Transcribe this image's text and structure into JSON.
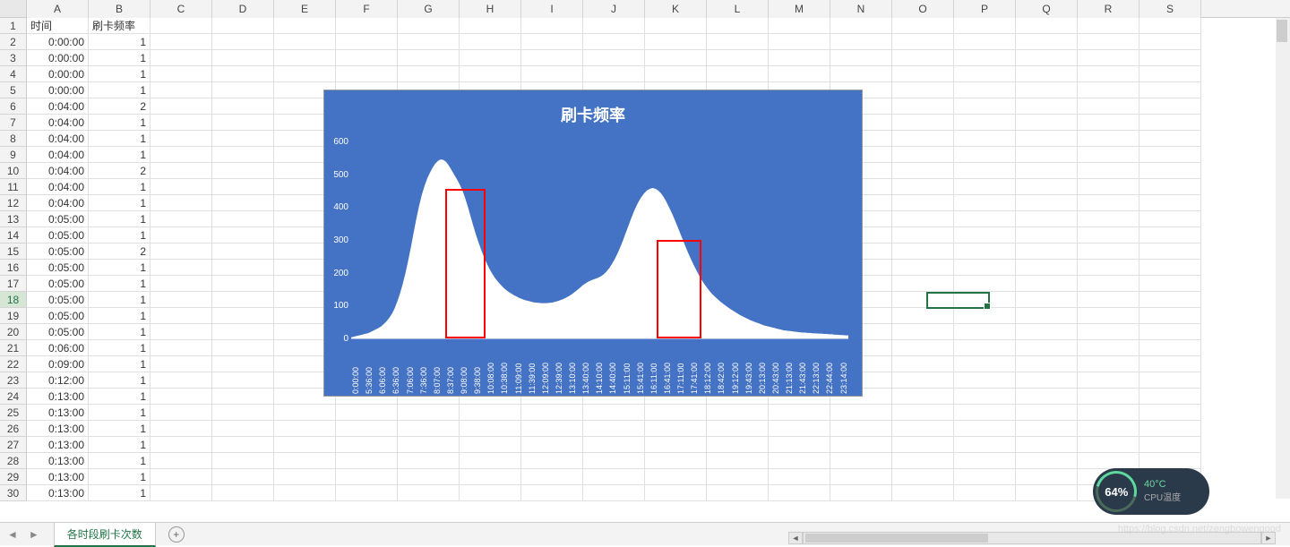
{
  "columns": [
    "A",
    "B",
    "C",
    "D",
    "E",
    "F",
    "G",
    "H",
    "I",
    "J",
    "K",
    "L",
    "M",
    "N",
    "O",
    "P",
    "Q",
    "R",
    "S"
  ],
  "row_count": 30,
  "headers": {
    "col_a": "时间",
    "col_b": "刷卡频率"
  },
  "data_rows": [
    {
      "time": "0:00:00",
      "freq": 1
    },
    {
      "time": "0:00:00",
      "freq": 1
    },
    {
      "time": "0:00:00",
      "freq": 1
    },
    {
      "time": "0:00:00",
      "freq": 1
    },
    {
      "time": "0:04:00",
      "freq": 2
    },
    {
      "time": "0:04:00",
      "freq": 1
    },
    {
      "time": "0:04:00",
      "freq": 1
    },
    {
      "time": "0:04:00",
      "freq": 1
    },
    {
      "time": "0:04:00",
      "freq": 2
    },
    {
      "time": "0:04:00",
      "freq": 1
    },
    {
      "time": "0:04:00",
      "freq": 1
    },
    {
      "time": "0:05:00",
      "freq": 1
    },
    {
      "time": "0:05:00",
      "freq": 1
    },
    {
      "time": "0:05:00",
      "freq": 2
    },
    {
      "time": "0:05:00",
      "freq": 1
    },
    {
      "time": "0:05:00",
      "freq": 1
    },
    {
      "time": "0:05:00",
      "freq": 1
    },
    {
      "time": "0:05:00",
      "freq": 1
    },
    {
      "time": "0:05:00",
      "freq": 1
    },
    {
      "time": "0:06:00",
      "freq": 1
    },
    {
      "time": "0:09:00",
      "freq": 1
    },
    {
      "time": "0:12:00",
      "freq": 1
    },
    {
      "time": "0:13:00",
      "freq": 1
    },
    {
      "time": "0:13:00",
      "freq": 1
    },
    {
      "time": "0:13:00",
      "freq": 1
    },
    {
      "time": "0:13:00",
      "freq": 1
    },
    {
      "time": "0:13:00",
      "freq": 1
    },
    {
      "time": "0:13:00",
      "freq": 1
    },
    {
      "time": "0:13:00",
      "freq": 1
    }
  ],
  "active_row": 18,
  "selected_cell": "O18",
  "sheet_tab": "各时段刷卡次数",
  "cpu_widget": {
    "percent": "64%",
    "temp": "40°C",
    "label": "CPU温度"
  },
  "watermark": "https://blog.csdn.net/zengbowengood",
  "chart_data": {
    "type": "area",
    "title": "刷卡频率",
    "ylabel": "",
    "xlabel": "",
    "ylim": [
      0,
      600
    ],
    "y_ticks": [
      0,
      100,
      200,
      300,
      400,
      500,
      600
    ],
    "x_ticks": [
      "0:00:00",
      "5:36:00",
      "6:06:00",
      "6:36:00",
      "7:06:00",
      "7:36:00",
      "8:07:00",
      "8:37:00",
      "9:08:00",
      "9:38:00",
      "10:08:00",
      "10:38:00",
      "11:09:00",
      "11:39:00",
      "12:09:00",
      "12:39:00",
      "13:10:00",
      "13:40:00",
      "14:10:00",
      "14:40:00",
      "15:11:00",
      "15:41:00",
      "16:11:00",
      "16:41:00",
      "17:11:00",
      "17:41:00",
      "18:12:00",
      "18:42:00",
      "19:12:00",
      "19:43:00",
      "20:13:00",
      "20:43:00",
      "21:13:00",
      "21:43:00",
      "22:13:00",
      "22:44:00",
      "23:14:00"
    ],
    "values": [
      3,
      5,
      7,
      9,
      11,
      13,
      15,
      18,
      22,
      26,
      30,
      35,
      42,
      50,
      60,
      72,
      88,
      108,
      132,
      160,
      192,
      228,
      268,
      310,
      350,
      388,
      420,
      446,
      468,
      485,
      500,
      512,
      520,
      524,
      522,
      516,
      505,
      492,
      478,
      465,
      450,
      432,
      410,
      384,
      356,
      328,
      302,
      278,
      256,
      236,
      218,
      202,
      188,
      176,
      166,
      157,
      149,
      142,
      136,
      131,
      126,
      122,
      118,
      115,
      112,
      110,
      108,
      106,
      105,
      104,
      103,
      103,
      103,
      104,
      105,
      107,
      109,
      112,
      115,
      119,
      123,
      128,
      134,
      140,
      147,
      154,
      160,
      165,
      169,
      172,
      175,
      178,
      182,
      188,
      196,
      206,
      218,
      232,
      248,
      266,
      286,
      307,
      329,
      350,
      370,
      388,
      403,
      416,
      426,
      434,
      438,
      440,
      438,
      433,
      425,
      414,
      400,
      384,
      367,
      349,
      330,
      310,
      290,
      270,
      251,
      233,
      216,
      200,
      185,
      171,
      159,
      148,
      138,
      129,
      121,
      114,
      107,
      101,
      95,
      89,
      84,
      79,
      74,
      69,
      65,
      61,
      57,
      53,
      50,
      47,
      44,
      41,
      38,
      36,
      34,
      32,
      30,
      28,
      26,
      24,
      23,
      22,
      21,
      20,
      19,
      18,
      17,
      17,
      16,
      16,
      15,
      15,
      14,
      14,
      13,
      13,
      12,
      12,
      11,
      11,
      10,
      10,
      9,
      9
    ]
  }
}
